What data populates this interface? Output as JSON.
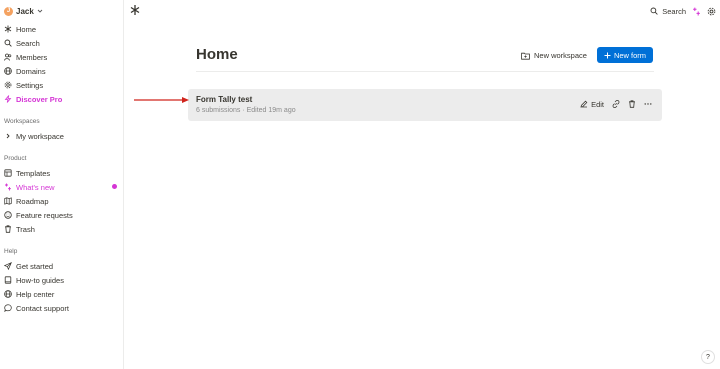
{
  "user": {
    "initial": "J",
    "name": "Jack"
  },
  "sidebar": {
    "main": [
      {
        "label": "Home",
        "icon": "star-icon"
      },
      {
        "label": "Search",
        "icon": "search-icon"
      },
      {
        "label": "Members",
        "icon": "members-icon"
      },
      {
        "label": "Domains",
        "icon": "globe-icon"
      },
      {
        "label": "Settings",
        "icon": "gear-icon"
      },
      {
        "label": "Discover Pro",
        "icon": "bolt-icon"
      }
    ],
    "workspaces_heading": "Workspaces",
    "workspaces": [
      {
        "label": "My workspace",
        "icon": "chevron-right-icon"
      }
    ],
    "product_heading": "Product",
    "product": [
      {
        "label": "Templates",
        "icon": "templates-icon"
      },
      {
        "label": "What's new",
        "icon": "sparkle-icon"
      },
      {
        "label": "Roadmap",
        "icon": "map-icon"
      },
      {
        "label": "Feature requests",
        "icon": "smile-icon"
      },
      {
        "label": "Trash",
        "icon": "trash-icon"
      }
    ],
    "help_heading": "Help",
    "help": [
      {
        "label": "Get started",
        "icon": "send-icon"
      },
      {
        "label": "How-to guides",
        "icon": "book-icon"
      },
      {
        "label": "Help center",
        "icon": "globe-icon"
      },
      {
        "label": "Contact support",
        "icon": "chat-icon"
      }
    ]
  },
  "topbar": {
    "search_label": "Search"
  },
  "main": {
    "title": "Home",
    "new_workspace_label": "New workspace",
    "new_form_label": "New form",
    "forms": [
      {
        "name": "Form Tally test",
        "meta": "6 submissions · Edited 19m ago",
        "edit_label": "Edit"
      }
    ]
  },
  "help_button_label": "?",
  "colors": {
    "accent": "#0070d7",
    "pro": "#d535d5",
    "arrow": "#d0241c",
    "card": "#ececec"
  }
}
